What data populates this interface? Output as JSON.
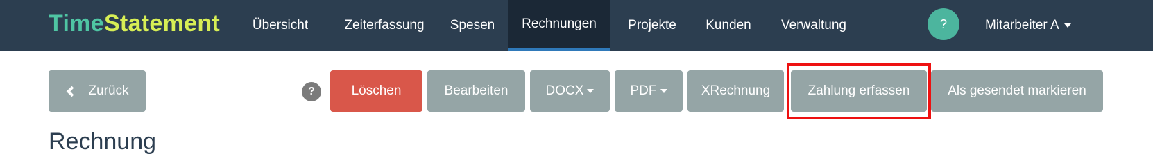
{
  "brand": {
    "part1": "Time",
    "part2": "Statement"
  },
  "nav": {
    "items": [
      {
        "label": "Übersicht"
      },
      {
        "label": "Zeiterfassung"
      },
      {
        "label": "Spesen"
      },
      {
        "label": "Rechnungen",
        "active": true
      },
      {
        "label": "Projekte"
      },
      {
        "label": "Kunden"
      },
      {
        "label": "Verwaltung"
      }
    ],
    "help_label": "?",
    "user_label": "Mitarbeiter A"
  },
  "toolbar": {
    "back_label": "Zurück",
    "help_label": "?",
    "delete_label": "Löschen",
    "edit_label": "Bearbeiten",
    "docx_label": "DOCX",
    "pdf_label": "PDF",
    "xrechnung_label": "XRechnung",
    "payment_label": "Zahlung erfassen",
    "mark_sent_label": "Als gesendet markieren"
  },
  "page": {
    "title": "Rechnung"
  },
  "colors": {
    "navbar": "#2c3e50",
    "brand_primary": "#4fc5a3",
    "brand_secondary": "#d7ee55",
    "button": "#95a5a6",
    "danger": "#d9574a",
    "highlight": "#ee1111"
  }
}
